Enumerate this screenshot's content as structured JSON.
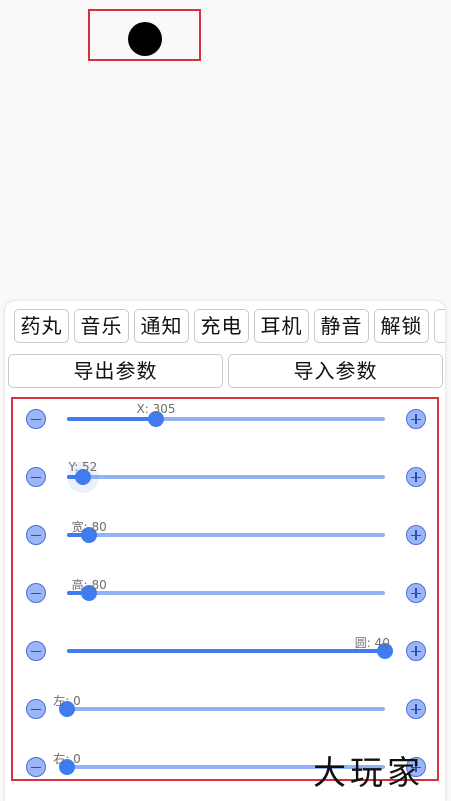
{
  "tabs": [
    "药丸",
    "音乐",
    "通知",
    "充电",
    "耳机",
    "静音",
    "解锁"
  ],
  "buttons": {
    "export": "导出参数",
    "import": "导入参数"
  },
  "sliders": [
    {
      "label": "X: 305",
      "fraction": 0.28
    },
    {
      "label": "Y: 52",
      "fraction": 0.05
    },
    {
      "label": "宽: 80",
      "fraction": 0.07
    },
    {
      "label": "高: 80",
      "fraction": 0.07
    },
    {
      "label": "圆: 40",
      "fraction": 1.0
    },
    {
      "label": "左: 0",
      "fraction": 0.0
    },
    {
      "label": "右: 0",
      "fraction": 0.0
    }
  ],
  "watermark": "大玩家",
  "colors": {
    "accent": "#3f7cf0",
    "track": "#93b3f6",
    "highlight_border": "#d9303c"
  }
}
